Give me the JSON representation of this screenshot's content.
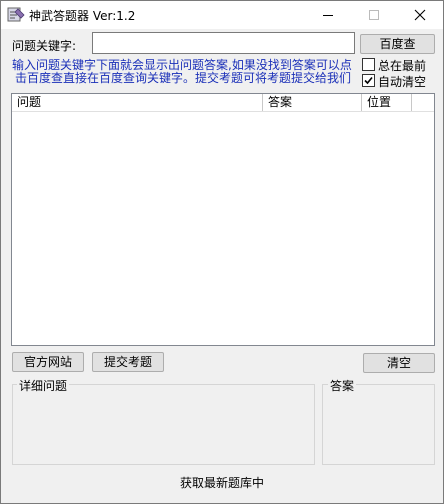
{
  "window": {
    "title": "神武答题器 Ver:1.2",
    "icon": "app-icon",
    "controls": {
      "minimize": "minimize-icon",
      "maximize": "maximize-icon",
      "close": "close-icon"
    }
  },
  "search": {
    "label": "问题关键字:",
    "value": "",
    "button_label": "百度查"
  },
  "hint": {
    "line1": "输入问题关键字下面就会显示出问题答案,如果没找到答案可以点",
    "line2": "击百度查直接在百度查询关键字。提交考题可将考题提交给我们"
  },
  "options": {
    "always_on_top": {
      "label": "总在最前",
      "checked": false
    },
    "auto_clear": {
      "label": "自动清空",
      "checked": true
    }
  },
  "results_table": {
    "columns": [
      "问题",
      "答案",
      "位置"
    ],
    "rows": []
  },
  "actions": {
    "official_site": "官方网站",
    "submit_question": "提交考题",
    "clear": "清空"
  },
  "detail": {
    "question_group": "详细问题",
    "question_text": "",
    "answer_group": "答案",
    "answer_text": ""
  },
  "status": "获取最新题库中",
  "colors": {
    "hint_text": "#1a2fb8",
    "window_bg": "#f0f0f0",
    "titlebar_bg": "#ffffff"
  }
}
